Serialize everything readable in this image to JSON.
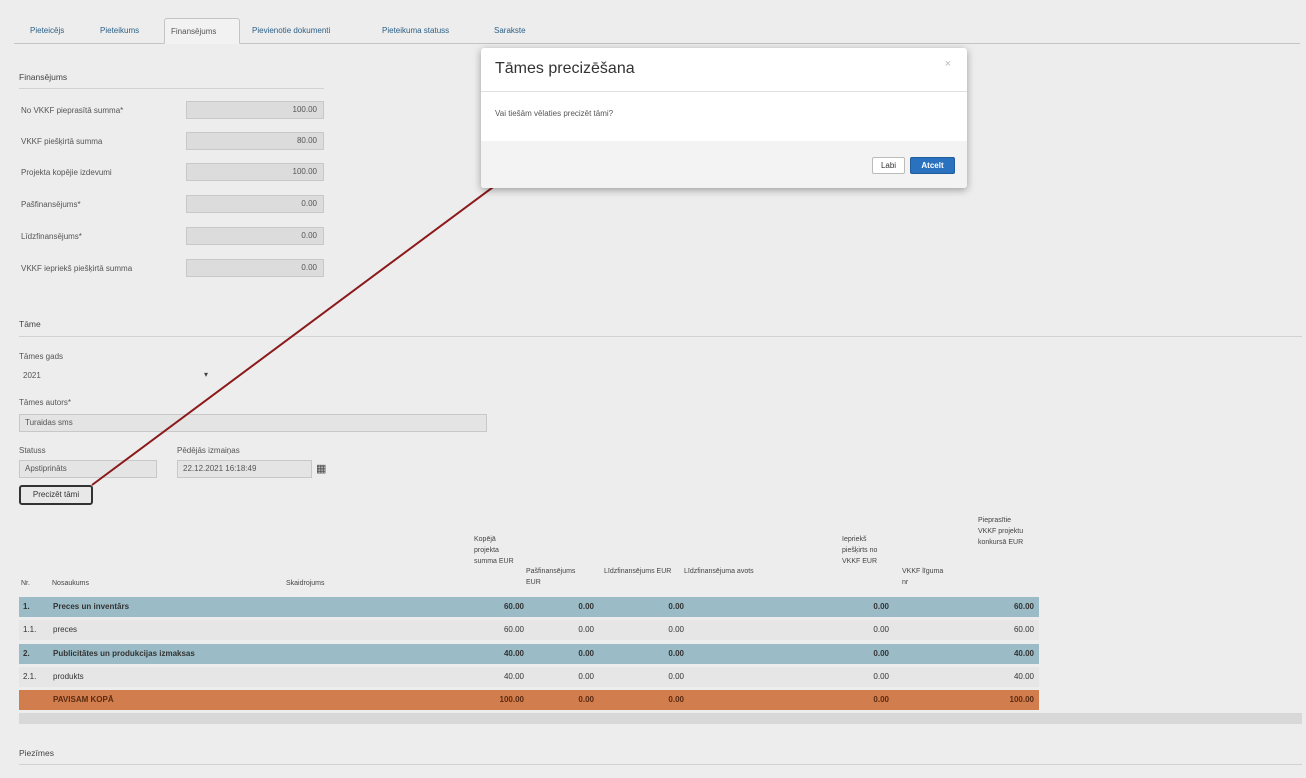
{
  "tabs": [
    {
      "label": "Pieteicējs"
    },
    {
      "label": "Pieteikums"
    },
    {
      "label": "Finansējums"
    },
    {
      "label": "Pievienotie dokumenti"
    },
    {
      "label": "Pieteikuma statuss"
    },
    {
      "label": "Sarakste"
    }
  ],
  "financing": {
    "title": "Finansējums",
    "fields": [
      {
        "label": "No VKKF pieprasītā summa*",
        "value": "100.00"
      },
      {
        "label": "VKKF piešķirtā summa",
        "value": "80.00"
      },
      {
        "label": "Projekta kopējie izdevumi",
        "value": "100.00"
      },
      {
        "label": "Pašfinansējums*",
        "value": "0.00"
      },
      {
        "label": "Līdzfinansējums*",
        "value": "0.00"
      },
      {
        "label": "VKKF iepriekš piešķirtā summa",
        "value": "0.00"
      }
    ]
  },
  "tame": {
    "title": "Tāme",
    "year_label": "Tāmes gads",
    "year_value": "2021",
    "author_label": "Tāmes autors*",
    "author_value": "Turaidas sms",
    "status_label": "Statuss",
    "status_value": "Apstiprināts",
    "change_label": "Pēdējās izmaiņas",
    "change_value": "22.12.2021 16:18:49",
    "button_label": "Precizēt tāmi"
  },
  "table": {
    "headers": {
      "nr": "Nr.",
      "name": "Nosaukums",
      "desc": "Skaidrojums",
      "total": "Kopējā projekta summa EUR",
      "self": "Pašfinansējums EUR",
      "co": "Līdzfinansējums EUR",
      "co_src": "Līdzfinansējuma avots",
      "prev": "Iepriekš piešķirts no VKKF EUR",
      "pct": "VKKF līguma nr",
      "req": "Pieprasītie VKKF projektu konkursā EUR"
    },
    "rows": [
      {
        "type": "cat",
        "nr": "1.",
        "name": "Preces un inventārs",
        "total": "60.00",
        "self": "0.00",
        "co": "0.00",
        "prev": "0.00",
        "req": "60.00"
      },
      {
        "type": "item",
        "nr": "1.1.",
        "name": "preces",
        "total": "60.00",
        "self": "0.00",
        "co": "0.00",
        "prev": "0.00",
        "req": "60.00"
      },
      {
        "type": "cat",
        "nr": "2.",
        "name": "Publicitātes un produkcijas izmaksas",
        "total": "40.00",
        "self": "0.00",
        "co": "0.00",
        "prev": "0.00",
        "req": "40.00"
      },
      {
        "type": "item",
        "nr": "2.1.",
        "name": "produkts",
        "total": "40.00",
        "self": "0.00",
        "co": "0.00",
        "prev": "0.00",
        "req": "40.00"
      },
      {
        "type": "total",
        "nr": "",
        "name": "PAVISAM KOPĀ",
        "total": "100.00",
        "self": "0.00",
        "co": "0.00",
        "prev": "0.00",
        "req": "100.00"
      }
    ]
  },
  "notes_label": "Piezīmes",
  "modal": {
    "title": "Tāmes precizēšana",
    "close": "×",
    "body": "Vai tiešām vēlaties precizēt tāmi?",
    "cancel": "Labi",
    "ok": "Atcelt"
  },
  "colors": {
    "category_row": "#9bbcc6",
    "total_row": "#d27d4d",
    "primary_button": "#2a72c0",
    "arrow": "#8b1a1a"
  }
}
